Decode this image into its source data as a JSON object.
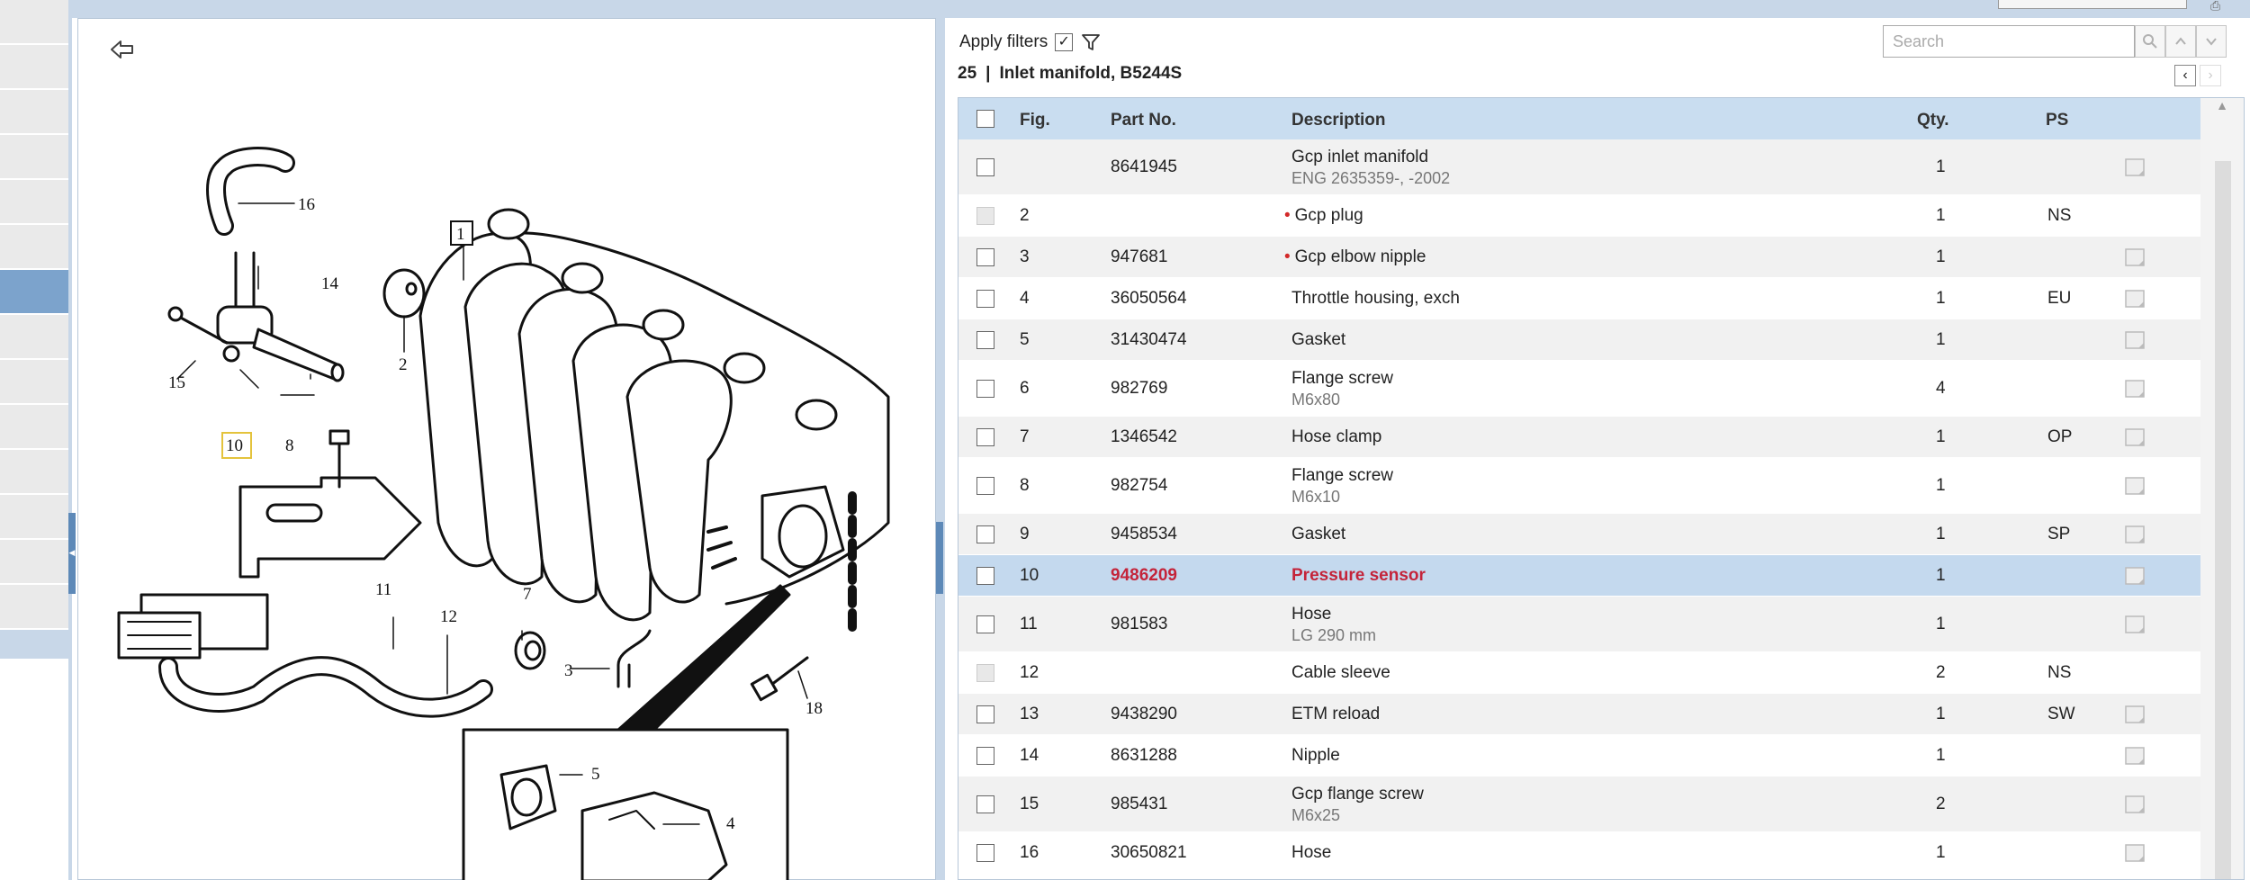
{
  "left_strip": {
    "row_count": 14,
    "selected_index": 6
  },
  "filter": {
    "label": "Apply filters",
    "checked": true
  },
  "search": {
    "placeholder": "Search"
  },
  "heading": {
    "number": "25",
    "separator": "|",
    "title": "Inlet manifold, B5244S"
  },
  "table": {
    "headers": {
      "fig": "Fig.",
      "part_no": "Part No.",
      "description": "Description",
      "qty": "Qty.",
      "ps": "PS"
    },
    "rows": [
      {
        "fig": "",
        "part_no": "8641945",
        "description": "Gcp inlet manifold",
        "sub": "ENG 2635359-, -2002",
        "qty": "1",
        "ps": "",
        "dot": false,
        "cart": true,
        "disabled": false,
        "selected": false
      },
      {
        "fig": "2",
        "part_no": "",
        "description": "Gcp plug",
        "sub": "",
        "qty": "1",
        "ps": "NS",
        "dot": true,
        "cart": false,
        "disabled": true,
        "selected": false
      },
      {
        "fig": "3",
        "part_no": "947681",
        "description": "Gcp elbow nipple",
        "sub": "",
        "qty": "1",
        "ps": "",
        "dot": true,
        "cart": true,
        "disabled": false,
        "selected": false
      },
      {
        "fig": "4",
        "part_no": "36050564",
        "description": "Throttle housing, exch",
        "sub": "",
        "qty": "1",
        "ps": "EU",
        "dot": false,
        "cart": true,
        "disabled": false,
        "selected": false
      },
      {
        "fig": "5",
        "part_no": "31430474",
        "description": "Gasket",
        "sub": "",
        "qty": "1",
        "ps": "",
        "dot": false,
        "cart": true,
        "disabled": false,
        "selected": false
      },
      {
        "fig": "6",
        "part_no": "982769",
        "description": "Flange screw",
        "sub": "M6x80",
        "qty": "4",
        "ps": "",
        "dot": false,
        "cart": true,
        "disabled": false,
        "selected": false
      },
      {
        "fig": "7",
        "part_no": "1346542",
        "description": "Hose clamp",
        "sub": "",
        "qty": "1",
        "ps": "OP",
        "dot": false,
        "cart": true,
        "disabled": false,
        "selected": false
      },
      {
        "fig": "8",
        "part_no": "982754",
        "description": "Flange screw",
        "sub": "M6x10",
        "qty": "1",
        "ps": "",
        "dot": false,
        "cart": true,
        "disabled": false,
        "selected": false
      },
      {
        "fig": "9",
        "part_no": "9458534",
        "description": "Gasket",
        "sub": "",
        "qty": "1",
        "ps": "SP",
        "dot": false,
        "cart": true,
        "disabled": false,
        "selected": false
      },
      {
        "fig": "10",
        "part_no": "9486209",
        "description": "Pressure sensor",
        "sub": "",
        "qty": "1",
        "ps": "",
        "dot": false,
        "cart": true,
        "disabled": false,
        "selected": true
      },
      {
        "fig": "11",
        "part_no": "981583",
        "description": "Hose",
        "sub": "LG 290 mm",
        "qty": "1",
        "ps": "",
        "dot": false,
        "cart": true,
        "disabled": false,
        "selected": false
      },
      {
        "fig": "12",
        "part_no": "",
        "description": "Cable sleeve",
        "sub": "",
        "qty": "2",
        "ps": "NS",
        "dot": false,
        "cart": false,
        "disabled": true,
        "selected": false
      },
      {
        "fig": "13",
        "part_no": "9438290",
        "description": "ETM reload",
        "sub": "",
        "qty": "1",
        "ps": "SW",
        "dot": false,
        "cart": true,
        "disabled": false,
        "selected": false
      },
      {
        "fig": "14",
        "part_no": "8631288",
        "description": "Nipple",
        "sub": "",
        "qty": "1",
        "ps": "",
        "dot": false,
        "cart": true,
        "disabled": false,
        "selected": false
      },
      {
        "fig": "15",
        "part_no": "985431",
        "description": "Gcp flange screw",
        "sub": "M6x25",
        "qty": "2",
        "ps": "",
        "dot": false,
        "cart": true,
        "disabled": false,
        "selected": false
      },
      {
        "fig": "16",
        "part_no": "30650821",
        "description": "Hose",
        "sub": "",
        "qty": "1",
        "ps": "",
        "dot": false,
        "cart": true,
        "disabled": false,
        "selected": false
      }
    ]
  },
  "diagram": {
    "callouts": [
      "1",
      "2",
      "3",
      "4",
      "5",
      "7",
      "8",
      "10",
      "11",
      "12",
      "14",
      "15",
      "16",
      "18"
    ],
    "highlighted_callout": "10"
  },
  "colors": {
    "accent": "#c8d7e8",
    "selected_row": "#c4d9ee",
    "selected_text": "#c4243a",
    "header": "#c9ddf0"
  }
}
